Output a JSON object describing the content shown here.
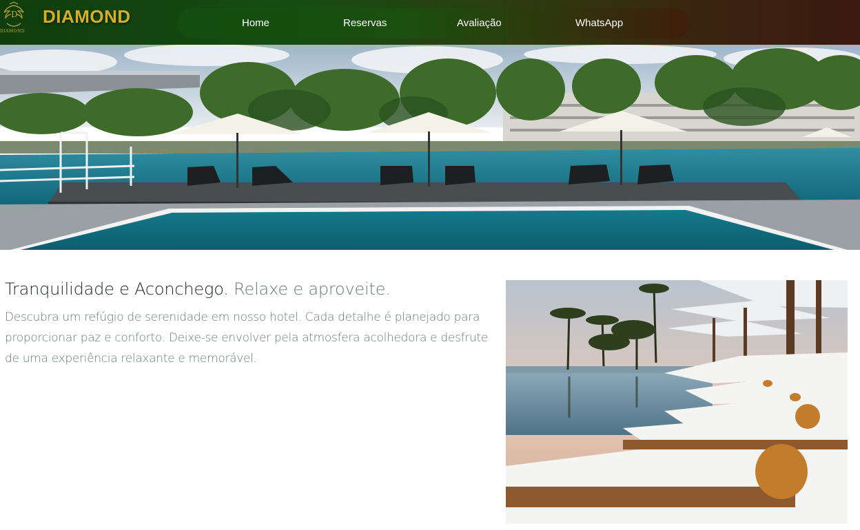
{
  "brand": {
    "name": "DIAMOND",
    "logo_icon": "diamond-crest-icon",
    "logo_letter": "D",
    "logo_word": "DIAMOND"
  },
  "nav": {
    "items": [
      {
        "label": "Home"
      },
      {
        "label": "Reservas"
      },
      {
        "label": "Avaliação"
      },
      {
        "label": "WhatsApp"
      }
    ]
  },
  "hero": {
    "image": "hotel-pool-hero-image"
  },
  "feature": {
    "heading_main": "Tranquilidade e Aconchego.",
    "heading_muted": "Relaxe e aproveite.",
    "paragraph": "Descubra um refúgio de serenidade em nosso hotel. Cada detalhe é planejado para proporcionar paz e conforto. Deixe-se envolver pela atmosfera acolhedora e desfrute de uma experiência relaxante e memorável.",
    "image": "poolside-loungers-image"
  },
  "colors": {
    "brand_gold": "#d6ae28",
    "nav_green": "#174d12",
    "nav_brown": "#3b1a10",
    "text_dark": "#212529",
    "text_muted": "#6c757d"
  }
}
